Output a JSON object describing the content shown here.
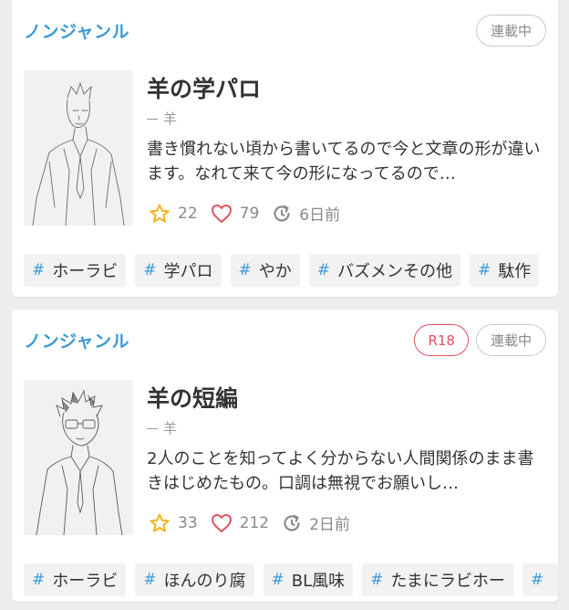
{
  "works": [
    {
      "genre": "ノンジャンル",
      "badges": [
        "連載中"
      ],
      "title": "羊の学パロ",
      "author": "羊",
      "description": "書き慣れない頃から書いてるので今と文章の形が違います。なれて来て今の形になってるので…",
      "stars": "22",
      "likes": "79",
      "updated": "6日前",
      "tags": [
        "ホーラビ",
        "学パロ",
        "やか",
        "バズメンその他",
        "駄作"
      ]
    },
    {
      "genre": "ノンジャンル",
      "badges": [
        "R18",
        "連載中"
      ],
      "title": "羊の短編",
      "author": "羊",
      "description": "2人のことを知ってよく分からない人間関係のまま書きはじめたもの。口調は無視でお願いし…",
      "stars": "33",
      "likes": "212",
      "updated": "2日前",
      "tags": [
        "ホーラビ",
        "ほんのり腐",
        "BL風味",
        "たまにラビホー",
        ""
      ]
    }
  ],
  "colors": {
    "accent": "#3a9ad9",
    "star": "#f1b41b",
    "heart": "#e0525e",
    "r18": "#e0525e"
  },
  "icons": {
    "star": "star-icon",
    "heart": "heart-icon",
    "updated": "clock-refresh-icon",
    "hash": "#"
  }
}
